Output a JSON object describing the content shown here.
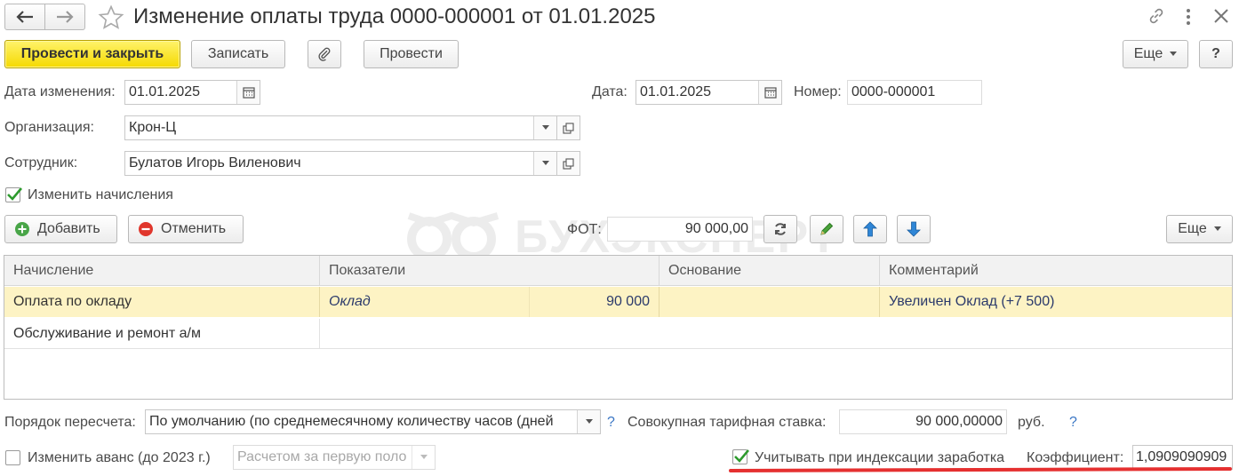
{
  "window": {
    "title": "Изменение оплаты труда 0000-000001 от 01.01.2025"
  },
  "toolbar": {
    "post_and_close": "Провести и закрыть",
    "save": "Записать",
    "post": "Провести",
    "more": "Еще",
    "help": "?"
  },
  "header": {
    "change_date_label": "Дата изменения:",
    "change_date_value": "01.01.2025",
    "date_label": "Дата:",
    "date_value": "01.01.2025",
    "number_label": "Номер:",
    "number_value": "0000-000001",
    "org_label": "Организация:",
    "org_value": "Крон-Ц",
    "employee_label": "Сотрудник:",
    "employee_value": "Булатов Игорь Виленович",
    "change_accruals_label": "Изменить начисления"
  },
  "accruals_toolbar": {
    "add": "Добавить",
    "cancel": "Отменить",
    "fot_label": "ФОТ:",
    "fot_value": "90 000,00",
    "more": "Еще"
  },
  "grid": {
    "columns": [
      "Начисление",
      "Показатели",
      "Основание",
      "Комментарий"
    ],
    "rows": [
      {
        "accrual": "Оплата по окладу",
        "indicator": "Оклад",
        "indicator_value": "90 000",
        "basis": "",
        "comment": "Увеличен Оклад (+7 500)"
      },
      {
        "accrual": "Обслуживание и ремонт а/м",
        "indicator": "",
        "indicator_value": "",
        "basis": "",
        "comment": ""
      }
    ]
  },
  "footer": {
    "recalc_label": "Порядок пересчета:",
    "recalc_value": "По умолчанию (по среднемесячному количеству часов (дней",
    "help": "?",
    "total_rate_label": "Совокупная тарифная ставка:",
    "total_rate_value": "90 000,00000",
    "currency": "руб.",
    "advance_label": "Изменить аванс (до 2023 г.)",
    "advance_value": "Расчетом за первую поло",
    "indexation_label": "Учитывать при индексации заработка",
    "coef_label": "Коэффициент:",
    "coef_value": "1,0909090909"
  },
  "watermark": "БУХЭКСПЕРТ",
  "colors": {
    "primary_button": "#f5d900",
    "selected_row": "#fdf3c4",
    "underline": "#e53030",
    "checkbox_tick": "#2d9a2d",
    "help": "#3a76c4"
  }
}
